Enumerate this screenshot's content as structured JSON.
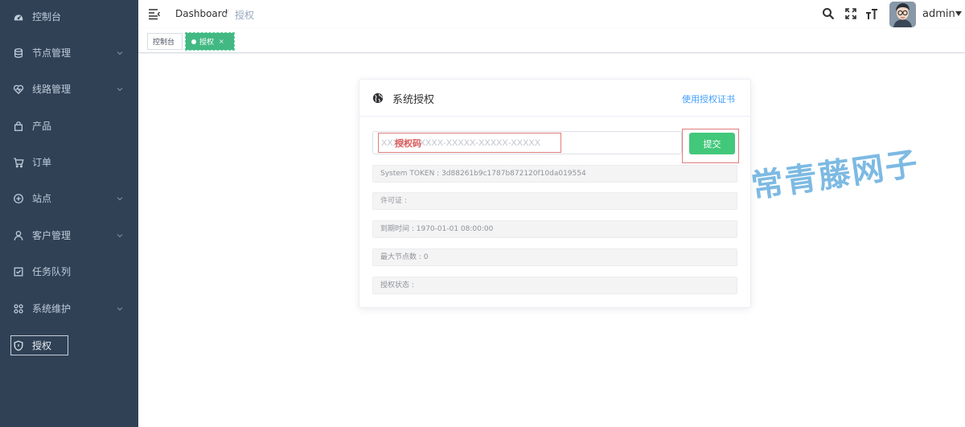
{
  "sidebar": {
    "items": [
      {
        "label": "控制台",
        "icon": "dashboard-icon",
        "submenu": false
      },
      {
        "label": "节点管理",
        "icon": "database-icon",
        "submenu": true
      },
      {
        "label": "线路管理",
        "icon": "heart-route-icon",
        "submenu": true
      },
      {
        "label": "产品",
        "icon": "bag-icon",
        "submenu": false
      },
      {
        "label": "订单",
        "icon": "cart-icon",
        "submenu": false
      },
      {
        "label": "站点",
        "icon": "site-icon",
        "submenu": true
      },
      {
        "label": "客户管理",
        "icon": "user-icon",
        "submenu": true
      },
      {
        "label": "任务队列",
        "icon": "checkbox-icon",
        "submenu": false
      },
      {
        "label": "系统维护",
        "icon": "grid-icon",
        "submenu": true
      },
      {
        "label": "授权",
        "icon": "shield-icon",
        "submenu": false,
        "active": true
      }
    ]
  },
  "navbar": {
    "breadcrumb_home": "Dashboard",
    "breadcrumb_sep": "/",
    "breadcrumb_current": "授权",
    "username": "admin"
  },
  "tags": {
    "items": [
      {
        "label": "控制台"
      },
      {
        "label": "授权",
        "active": true,
        "close": "×"
      }
    ]
  },
  "license": {
    "title": "系统授权",
    "cert_link": "使用授权证书",
    "code_placeholder": "XXXXX-XXXXX-XXXXX-XXXXX-XXXXX",
    "code_annotation": "授权码",
    "submit_label": "提交",
    "rows": [
      "System TOKEN : 3d88261b9c1787b872120f10da019554",
      "许可证 :",
      "到期时间 : 1970-01-01 08:00:00",
      "最大节点数 : 0",
      "授权状态 :"
    ]
  },
  "watermark": "常青藤网子",
  "colors": {
    "sidebar_bg": "#304156",
    "accent_green": "#42c87b",
    "link_blue": "#409eff",
    "watermark": "#6fb3e0"
  }
}
